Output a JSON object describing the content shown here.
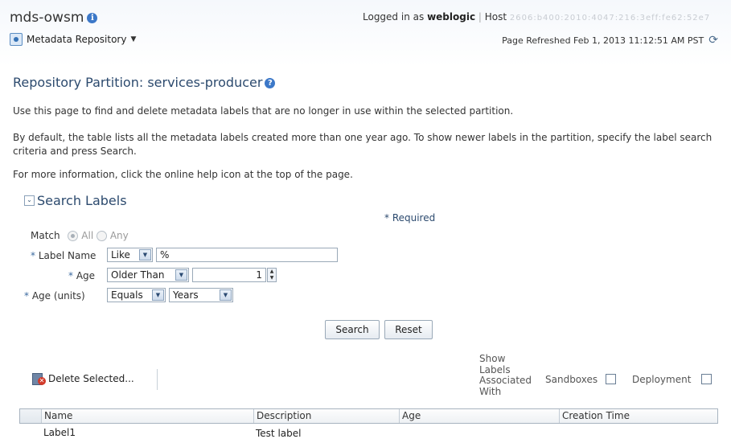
{
  "app": {
    "title": "mds-owsm",
    "info_icon": "i",
    "repo_menu": "Metadata Repository",
    "logged_in_prefix": "Logged in as",
    "user": "weblogic",
    "host_label": "Host",
    "host_value": "2606:b400:2010:4047:216:3eff:fe62:52e7",
    "refreshed": "Page Refreshed Feb 1, 2013 11:12:51 AM PST",
    "refresh_icon": "refresh-icon"
  },
  "page": {
    "title": "Repository Partition: services-producer",
    "help_icon": "?",
    "para1": "Use this page to find and delete metadata labels that are no longer in use within the selected partition.",
    "para2": "By default, the table lists all the metadata labels created more than one year ago. To show newer labels in the partition, specify the label search criteria and press Search.",
    "para3": "For more information, click the online help icon at the top of the page."
  },
  "search": {
    "header": "Search Labels",
    "disclose": "⌄",
    "required_note": "* Required",
    "match_label": "Match",
    "match_all": "All",
    "match_any": "Any",
    "label_name_label": "Label Name",
    "label_name_operator": "Like",
    "label_name_value": "%",
    "age_label": "Age",
    "age_operator": "Older Than",
    "age_value": "1",
    "age_units_label": "Age (units)",
    "age_units_operator": "Equals",
    "age_units_value": "Years",
    "search_button": "Search",
    "reset_button": "Reset"
  },
  "toolbar": {
    "delete_selected": "Delete Selected...",
    "show_labels_line1": "Show",
    "show_labels_line2": "Labels",
    "show_labels_line3": "Associated",
    "show_labels_line4": "With",
    "sandboxes": "Sandboxes",
    "deployment": "Deployment"
  },
  "table": {
    "columns": [
      "Name",
      "Description",
      "Age",
      "Creation Time"
    ],
    "rows": [
      {
        "name": "Label1",
        "description": "Test label"
      }
    ]
  }
}
